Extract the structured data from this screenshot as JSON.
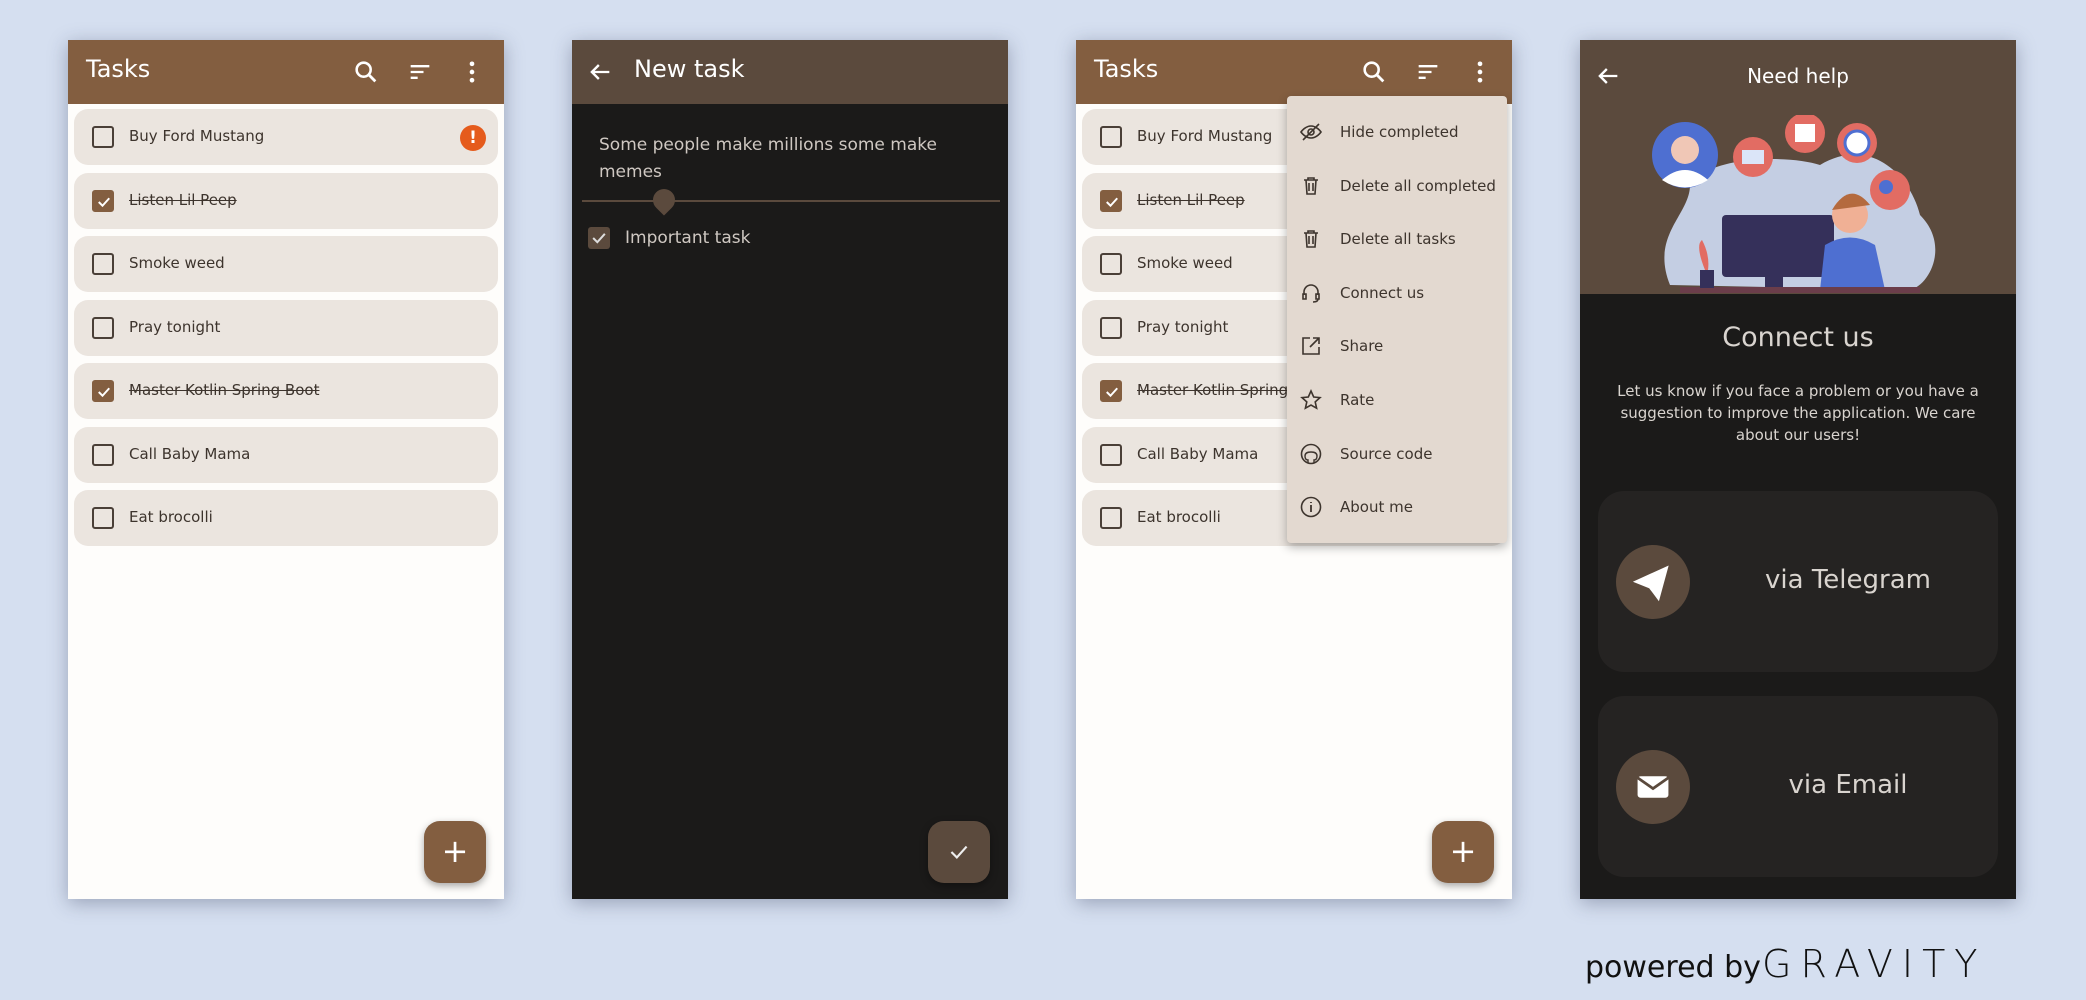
{
  "screen1": {
    "title": "Tasks",
    "fab": "+",
    "tasks": [
      {
        "label": "Buy Ford Mustang",
        "done": false,
        "important": true
      },
      {
        "label": "Listen Lil Peep",
        "done": true
      },
      {
        "label": "Smoke weed",
        "done": false
      },
      {
        "label": "Pray tonight",
        "done": false
      },
      {
        "label": "Master Kotlin Spring Boot",
        "done": true
      },
      {
        "label": "Call Baby Mama",
        "done": false
      },
      {
        "label": "Eat brocolli",
        "done": false
      }
    ]
  },
  "screen2": {
    "title": "New task",
    "input_value": "Some people make millions some make memes",
    "important_label": "Important task",
    "important_checked": true
  },
  "screen3": {
    "title": "Tasks",
    "fab": "+",
    "tasks": [
      {
        "label": "Buy Ford Mustang",
        "done": false
      },
      {
        "label": "Listen Lil Peep",
        "done": true
      },
      {
        "label": "Smoke weed",
        "done": false
      },
      {
        "label": "Pray tonight",
        "done": false
      },
      {
        "label": "Master Kotlin Spring Boot",
        "done": true
      },
      {
        "label": "Call Baby Mama",
        "done": false
      },
      {
        "label": "Eat brocolli",
        "done": false
      }
    ],
    "menu": [
      {
        "label": "Hide completed",
        "icon": "eye-off-icon"
      },
      {
        "label": "Delete all completed",
        "icon": "trash-icon"
      },
      {
        "label": "Delete all tasks",
        "icon": "trash-icon"
      },
      {
        "label": "Connect us",
        "icon": "headset-icon"
      },
      {
        "label": "Share",
        "icon": "share-icon"
      },
      {
        "label": "Rate",
        "icon": "star-icon"
      },
      {
        "label": "Source code",
        "icon": "github-icon"
      },
      {
        "label": "About me",
        "icon": "info-icon"
      }
    ]
  },
  "screen4": {
    "title": "Need help",
    "heading": "Connect us",
    "description": "Let us know if you face a problem or you have a suggestion to improve the application. We care about our users!",
    "telegram": "via Telegram",
    "email": "via Email"
  },
  "footer": {
    "powered": "powered by",
    "brand": "GRAVITY"
  },
  "colors": {
    "primary": "#835e40",
    "dark_header": "#5b4a3d",
    "row": "#ebe5df",
    "important": "#e55b1c"
  }
}
